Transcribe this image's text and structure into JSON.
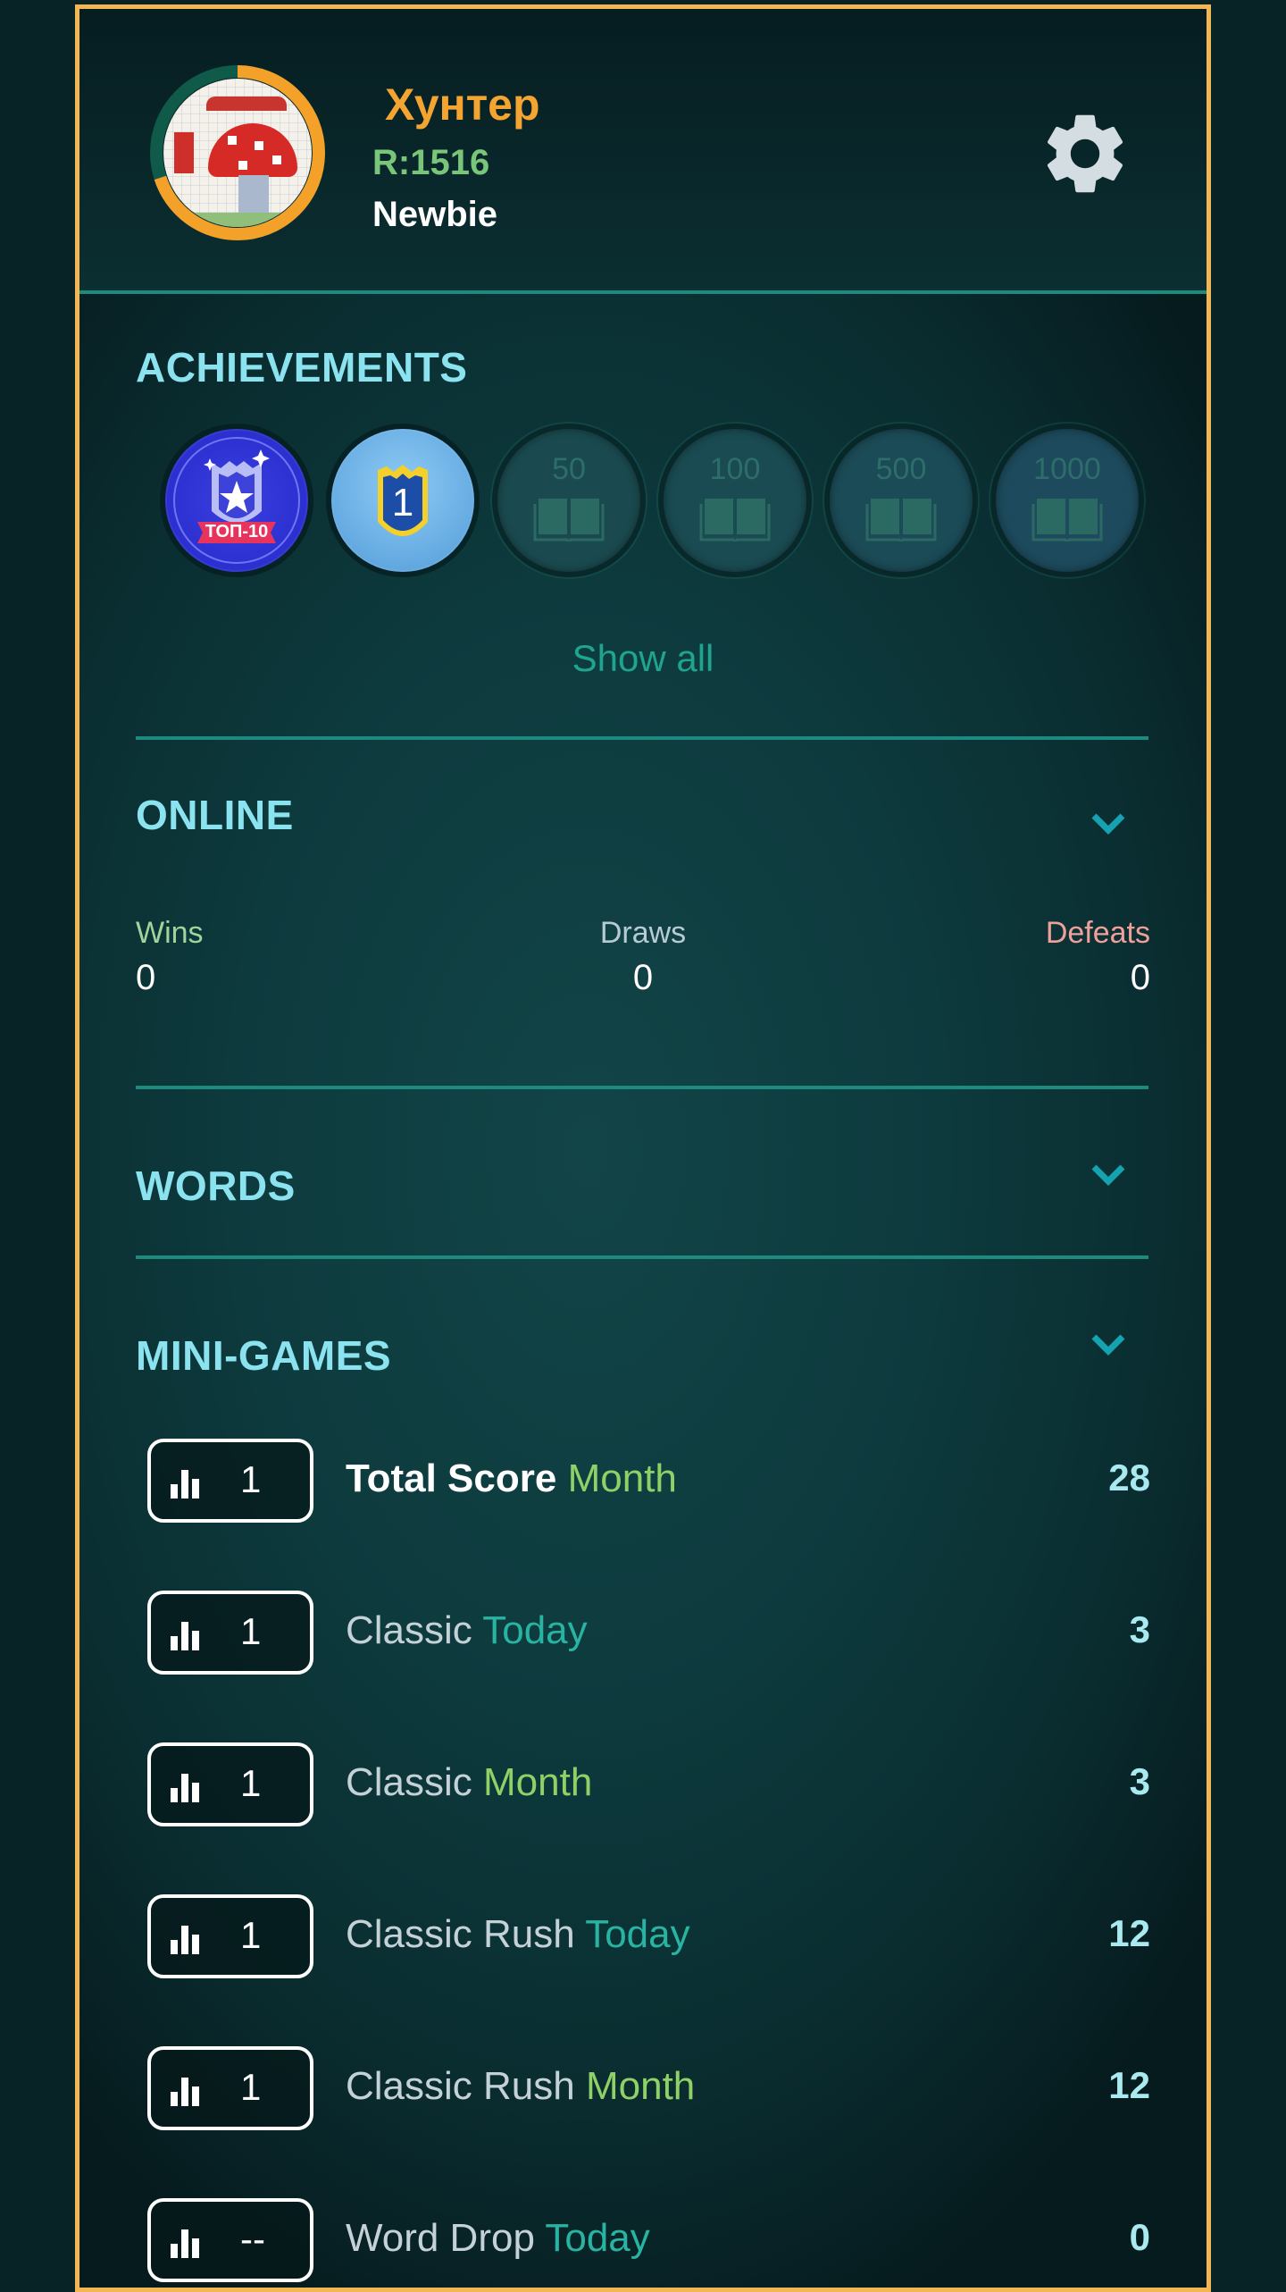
{
  "colors": {
    "frame_border": "#f2b653",
    "accent_title": "#8be3ef",
    "name": "#f4a430",
    "rating": "#79c67a",
    "today": "#28b3a2",
    "month": "#8fd166",
    "wins": "#9fd49a",
    "draws": "#b7cbd3",
    "defeats": "#f0a09a"
  },
  "profile": {
    "name": "Хунтер",
    "rating": "R:1516",
    "rank": "Newbie",
    "level_progress": 0.7,
    "avatar_icon": "mushroom-pixel-art-avatar"
  },
  "header": {
    "settings_icon": "gear-icon"
  },
  "achievements": {
    "title": "ACHIEVEMENTS",
    "badges": [
      {
        "name": "top-10-badge",
        "label": "ТОП-10",
        "unlocked": true
      },
      {
        "name": "first-place-badge",
        "label": "1",
        "unlocked": true
      },
      {
        "name": "words-50-badge",
        "label": "50",
        "unlocked": false
      },
      {
        "name": "words-100-badge",
        "label": "100",
        "unlocked": false
      },
      {
        "name": "words-500-badge",
        "label": "500",
        "unlocked": false
      },
      {
        "name": "words-1000-badge",
        "label": "1000",
        "unlocked": false
      }
    ],
    "show_all": "Show all"
  },
  "online": {
    "title": "ONLINE",
    "wins_label": "Wins",
    "wins": "0",
    "draws_label": "Draws",
    "draws": "0",
    "defeats_label": "Defeats",
    "defeats": "0"
  },
  "words": {
    "title": "WORDS"
  },
  "minigames": {
    "title": "MINI-GAMES",
    "rows": [
      {
        "rank": "1",
        "name": "Total Score",
        "period": "Month",
        "period_type": "month",
        "value": "28",
        "bold": true
      },
      {
        "rank": "1",
        "name": "Classic",
        "period": "Today",
        "period_type": "today",
        "value": "3",
        "bold": false
      },
      {
        "rank": "1",
        "name": "Classic",
        "period": "Month",
        "period_type": "month",
        "value": "3",
        "bold": false
      },
      {
        "rank": "1",
        "name": "Classic Rush",
        "period": "Today",
        "period_type": "today",
        "value": "12",
        "bold": false
      },
      {
        "rank": "1",
        "name": "Classic Rush",
        "period": "Month",
        "period_type": "month",
        "value": "12",
        "bold": false
      },
      {
        "rank": "--",
        "name": "Word Drop",
        "period": "Today",
        "period_type": "today",
        "value": "0",
        "bold": false
      }
    ]
  }
}
